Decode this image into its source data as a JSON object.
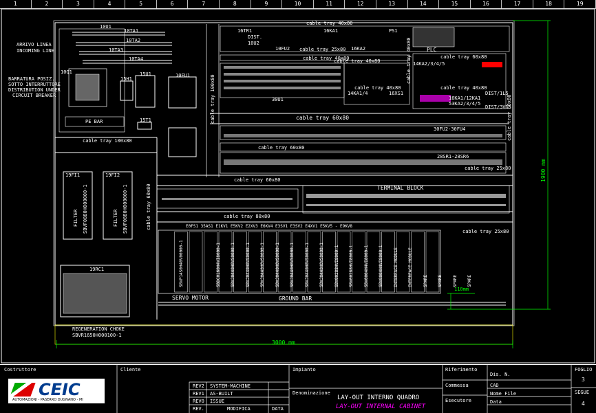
{
  "ruler": [
    "1",
    "2",
    "3",
    "4",
    "5",
    "6",
    "7",
    "8",
    "9",
    "10",
    "11",
    "12",
    "13",
    "14",
    "15",
    "16",
    "17",
    "18",
    "19"
  ],
  "labels": {
    "arrivo": "ARRIVO LINEA",
    "incoming": "INCOMING LINE",
    "barratura1": "BARRATURA POSIZ.",
    "barratura2": "SOTTO INTERRUTTORE",
    "barratura3": "DISTRIBUTION UNDER",
    "barratura4": "CIRCUIT BREAKER",
    "pebar": "PE BAR",
    "qs1": "10U1",
    "ta1": "10TA1",
    "ta2": "10TA2",
    "ta3": "10TA3",
    "ta4": "10TA4",
    "q1": "10Q1",
    "u1": "15U1",
    "fu1": "10FU1",
    "st1": "15T1",
    "h1": "15H1",
    "tr1": "16TR1",
    "dist": "DIST.",
    "dist2": "10U2",
    "fu2": "10FU2",
    "k1": "16KA1",
    "k2": "16KA2",
    "ps": "PS1",
    "plc": "PLC",
    "ct_40x80a": "cable tray 40x80",
    "ct_25x80a": "cable tray 25x80",
    "ct_40x80b": "cable tray 40x80",
    "ct_60x80a": "cable tray 60x80",
    "ct_40x80c": "cable tray 40x80",
    "ct_40x80d": "cable tray 40x80",
    "ct_40x80e": "cable tray 40x80",
    "ct_60x80b": "cable tray 60x80",
    "ct_60x80c": "cable tray 60x80",
    "ct_100x80a": "cable tray 100x80",
    "ct_100x80b": "cable tray 100x80",
    "ct_60x80d": "cable tray 60x80",
    "ct_60x80e": "cable tray 60x80",
    "ct_25x80b": "cable tray 25x80",
    "ct_60x80f": "cable tray 60x80",
    "ct_60x80g": "cable tray 60x80",
    "ct_80x80": "cable tray 80x80",
    "ct_25x80c": "cable tray 25x80",
    "u30": "30U1",
    "fu3": "30FU2-30FU4",
    "srs": "28SR1-28SR6",
    "terminal": "TERMINAL BLOCK",
    "xs1": "16XS1",
    "xs2": "16XS1",
    "k3": "14KA1/4",
    "k4": "14KA2/3/4/5",
    "ka": "16KA1/12KA1",
    "ka2": "53KA2/3/4/5",
    "dist3": "DIST/1L5",
    "dist4": "DIST/3V15",
    "filter1": "FILTER",
    "filter2": "FILTER",
    "f1code": "SBVF0880H000000-1",
    "f2code": "SBVF0880H000000-1",
    "ft1": "19FI1",
    "ft2": "19FI2",
    "choke": "19RC1",
    "servo": "SERVO MOTOR",
    "ground": "GROUND BAR",
    "dim110": "110mm",
    "dim3000": "3000 mm",
    "dim1900": "1900 mm",
    "regen1": "REGENERATION CHOKE",
    "regen2": "SBVR1650H000100-1",
    "rowhead": "E0FS1  35AS1 E1KV1  E5KV2  E2XV3 E6KV4  E3SV1  E3SV2  E4XV1      E5KV5 - E9KV8",
    "modules": [
      "SBVP14S0H40V00000-1",
      "SBDC0160H4VI8000-1",
      "SBVJ0440H0VS0000-1",
      "SBVJ0440H0VS0000-1",
      "SBVJ0440H0VS0000-1",
      "SBVJ0440H0VS0000-1",
      "SBVJ0440H0VS0000-1",
      "SBVJ0440H0VS0000-1",
      "SBVJ0440H0VS0000-1",
      "SBV00288HVI8000-1",
      "SBV00288HVI8000-1",
      "SBV0004H4VI8000-1",
      "SBV0004H4VI8000-1",
      "INTERFACE MODULE",
      "INTERFACE MODULE",
      "SPARE",
      "SPARE",
      "SPARE",
      "SPARE"
    ]
  },
  "titleblock": {
    "costruttore": "Costruttore",
    "cliente": "Cliente",
    "logo_name": "CEIC",
    "logo_sub": "AUTOMAZIONI - PASERRO DUGNANO - MI",
    "rev2": "REV2",
    "rev1": "REV1",
    "rev0": "REV0",
    "rev": "REV.",
    "rev2_desc": "SYSTEM-MACHINE",
    "rev1_desc": "AS-BUILT",
    "rev0_desc": "ISSUE",
    "modifica": "MODIFICA",
    "data": "DATA",
    "impianto": "Impianto",
    "denominazione": "Denominazione",
    "title_it": "LAY-OUT INTERNO QUADRO",
    "title_en": "LAY-OUT INTERNAL CABINET",
    "riferimento": "Riferimento",
    "commessa": "Commessa",
    "esecutore": "Esecutore",
    "dis_n": "Dis. N.",
    "cad": "CAD",
    "nome_file": "Nome File",
    "data_lbl": "Data",
    "foglio": "FOGLIO",
    "foglio_val": "3",
    "segue": "SEGUE",
    "segue_val": "4"
  },
  "colors": {
    "line": "#ffffff",
    "dim": "#00ff00",
    "tray": "#ffffff",
    "accent": "#ff00ff"
  }
}
